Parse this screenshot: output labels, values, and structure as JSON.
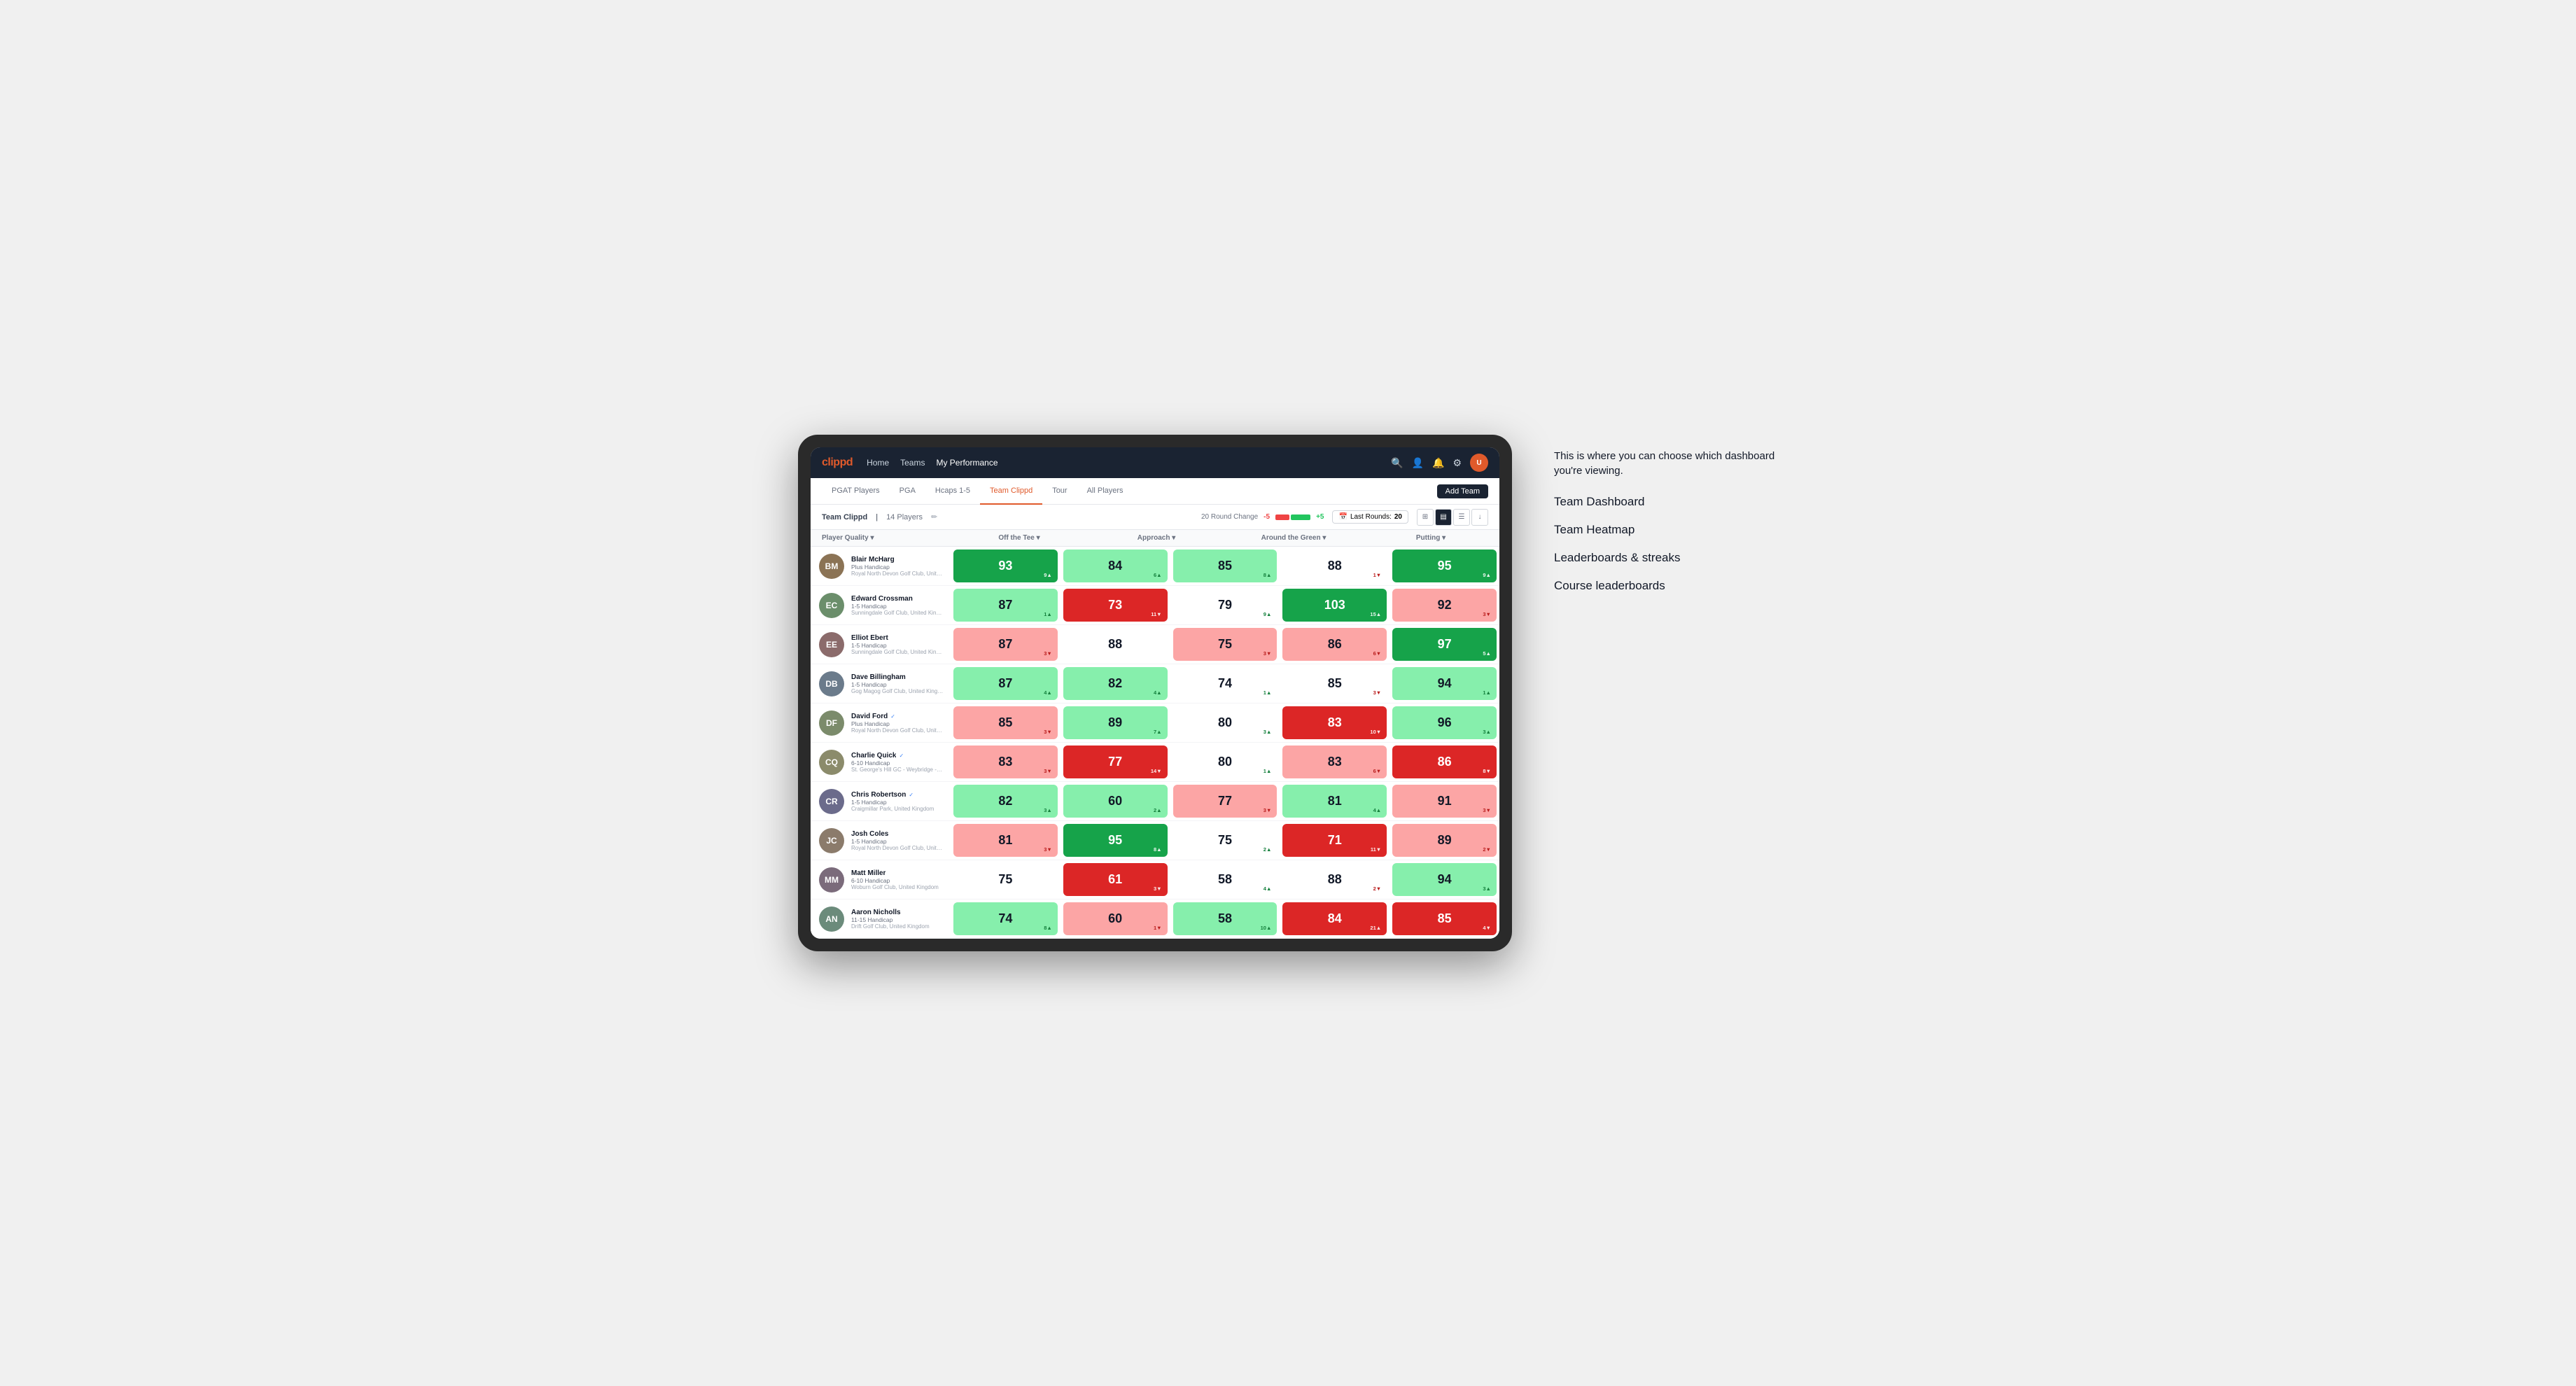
{
  "annotation": {
    "description": "This is where you can choose which dashboard you're viewing.",
    "items": [
      "Team Dashboard",
      "Team Heatmap",
      "Leaderboards & streaks",
      "Course leaderboards"
    ]
  },
  "nav": {
    "logo": "clippd",
    "links": [
      "Home",
      "Teams",
      "My Performance"
    ],
    "active_link": "My Performance"
  },
  "tabs": {
    "items": [
      "PGAT Players",
      "PGA",
      "Hcaps 1-5",
      "Team Clippd",
      "Tour",
      "All Players"
    ],
    "active": "Team Clippd",
    "add_button": "Add Team"
  },
  "subheader": {
    "team_name": "Team Clippd",
    "player_count": "14 Players",
    "round_change_label": "20 Round Change",
    "round_change_neg": "-5",
    "round_change_pos": "+5",
    "last_rounds_label": "Last Rounds:",
    "last_rounds_value": "20"
  },
  "table": {
    "columns": [
      "Player Quality ▾",
      "Off the Tee ▾",
      "Approach ▾",
      "Around the Green ▾",
      "Putting ▾"
    ],
    "players": [
      {
        "name": "Blair McHarg",
        "handicap": "Plus Handicap",
        "club": "Royal North Devon Golf Club, United Kingdom",
        "verified": false,
        "avatar_color": "#8B7355",
        "initials": "BM",
        "metrics": [
          {
            "value": "93",
            "change": "9",
            "dir": "up",
            "bg": "bg-green-strong"
          },
          {
            "value": "84",
            "change": "6",
            "dir": "up",
            "bg": "bg-green-light"
          },
          {
            "value": "85",
            "change": "8",
            "dir": "up",
            "bg": "bg-green-light"
          },
          {
            "value": "88",
            "change": "1",
            "dir": "down",
            "bg": "bg-white"
          },
          {
            "value": "95",
            "change": "9",
            "dir": "up",
            "bg": "bg-green-strong"
          }
        ]
      },
      {
        "name": "Edward Crossman",
        "handicap": "1-5 Handicap",
        "club": "Sunningdale Golf Club, United Kingdom",
        "verified": false,
        "avatar_color": "#6B8E6B",
        "initials": "EC",
        "metrics": [
          {
            "value": "87",
            "change": "1",
            "dir": "up",
            "bg": "bg-green-light"
          },
          {
            "value": "73",
            "change": "11",
            "dir": "down",
            "bg": "bg-red-strong"
          },
          {
            "value": "79",
            "change": "9",
            "dir": "up",
            "bg": "bg-white"
          },
          {
            "value": "103",
            "change": "15",
            "dir": "up",
            "bg": "bg-green-strong"
          },
          {
            "value": "92",
            "change": "3",
            "dir": "down",
            "bg": "bg-red-light"
          }
        ]
      },
      {
        "name": "Elliot Ebert",
        "handicap": "1-5 Handicap",
        "club": "Sunningdale Golf Club, United Kingdom",
        "verified": false,
        "avatar_color": "#8B6B6B",
        "initials": "EE",
        "metrics": [
          {
            "value": "87",
            "change": "3",
            "dir": "down",
            "bg": "bg-red-light"
          },
          {
            "value": "88",
            "change": "",
            "dir": "neutral",
            "bg": "bg-white"
          },
          {
            "value": "75",
            "change": "3",
            "dir": "down",
            "bg": "bg-red-light"
          },
          {
            "value": "86",
            "change": "6",
            "dir": "down",
            "bg": "bg-red-light"
          },
          {
            "value": "97",
            "change": "5",
            "dir": "up",
            "bg": "bg-green-strong"
          }
        ]
      },
      {
        "name": "Dave Billingham",
        "handicap": "1-5 Handicap",
        "club": "Gog Magog Golf Club, United Kingdom",
        "verified": false,
        "avatar_color": "#6B7B8B",
        "initials": "DB",
        "metrics": [
          {
            "value": "87",
            "change": "4",
            "dir": "up",
            "bg": "bg-green-light"
          },
          {
            "value": "82",
            "change": "4",
            "dir": "up",
            "bg": "bg-green-light"
          },
          {
            "value": "74",
            "change": "1",
            "dir": "up",
            "bg": "bg-white"
          },
          {
            "value": "85",
            "change": "3",
            "dir": "down",
            "bg": "bg-white"
          },
          {
            "value": "94",
            "change": "1",
            "dir": "up",
            "bg": "bg-green-light"
          }
        ]
      },
      {
        "name": "David Ford",
        "handicap": "Plus Handicap",
        "club": "Royal North Devon Golf Club, United Kingdom",
        "verified": true,
        "avatar_color": "#7B8B6B",
        "initials": "DF",
        "metrics": [
          {
            "value": "85",
            "change": "3",
            "dir": "down",
            "bg": "bg-red-light"
          },
          {
            "value": "89",
            "change": "7",
            "dir": "up",
            "bg": "bg-green-light"
          },
          {
            "value": "80",
            "change": "3",
            "dir": "up",
            "bg": "bg-white"
          },
          {
            "value": "83",
            "change": "10",
            "dir": "down",
            "bg": "bg-red-strong"
          },
          {
            "value": "96",
            "change": "3",
            "dir": "up",
            "bg": "bg-green-light"
          }
        ]
      },
      {
        "name": "Charlie Quick",
        "handicap": "6-10 Handicap",
        "club": "St. George's Hill GC - Weybridge - Surrey, Uni...",
        "verified": true,
        "avatar_color": "#8B8B6B",
        "initials": "CQ",
        "metrics": [
          {
            "value": "83",
            "change": "3",
            "dir": "down",
            "bg": "bg-red-light"
          },
          {
            "value": "77",
            "change": "14",
            "dir": "down",
            "bg": "bg-red-strong"
          },
          {
            "value": "80",
            "change": "1",
            "dir": "up",
            "bg": "bg-white"
          },
          {
            "value": "83",
            "change": "6",
            "dir": "down",
            "bg": "bg-red-light"
          },
          {
            "value": "86",
            "change": "8",
            "dir": "down",
            "bg": "bg-red-strong"
          }
        ]
      },
      {
        "name": "Chris Robertson",
        "handicap": "1-5 Handicap",
        "club": "Craigmillar Park, United Kingdom",
        "verified": true,
        "avatar_color": "#6B6B8B",
        "initials": "CR",
        "metrics": [
          {
            "value": "82",
            "change": "3",
            "dir": "up",
            "bg": "bg-green-light"
          },
          {
            "value": "60",
            "change": "2",
            "dir": "up",
            "bg": "bg-green-light"
          },
          {
            "value": "77",
            "change": "3",
            "dir": "down",
            "bg": "bg-red-light"
          },
          {
            "value": "81",
            "change": "4",
            "dir": "up",
            "bg": "bg-green-light"
          },
          {
            "value": "91",
            "change": "3",
            "dir": "down",
            "bg": "bg-red-light"
          }
        ]
      },
      {
        "name": "Josh Coles",
        "handicap": "1-5 Handicap",
        "club": "Royal North Devon Golf Club, United Kingdom",
        "verified": false,
        "avatar_color": "#8B7B6B",
        "initials": "JC",
        "metrics": [
          {
            "value": "81",
            "change": "3",
            "dir": "down",
            "bg": "bg-red-light"
          },
          {
            "value": "95",
            "change": "8",
            "dir": "up",
            "bg": "bg-green-strong"
          },
          {
            "value": "75",
            "change": "2",
            "dir": "up",
            "bg": "bg-white"
          },
          {
            "value": "71",
            "change": "11",
            "dir": "down",
            "bg": "bg-red-strong"
          },
          {
            "value": "89",
            "change": "2",
            "dir": "down",
            "bg": "bg-red-light"
          }
        ]
      },
      {
        "name": "Matt Miller",
        "handicap": "6-10 Handicap",
        "club": "Woburn Golf Club, United Kingdom",
        "verified": false,
        "avatar_color": "#7B6B7B",
        "initials": "MM",
        "metrics": [
          {
            "value": "75",
            "change": "",
            "dir": "neutral",
            "bg": "bg-white"
          },
          {
            "value": "61",
            "change": "3",
            "dir": "down",
            "bg": "bg-red-strong"
          },
          {
            "value": "58",
            "change": "4",
            "dir": "up",
            "bg": "bg-white"
          },
          {
            "value": "88",
            "change": "2",
            "dir": "down",
            "bg": "bg-white"
          },
          {
            "value": "94",
            "change": "3",
            "dir": "up",
            "bg": "bg-green-light"
          }
        ]
      },
      {
        "name": "Aaron Nicholls",
        "handicap": "11-15 Handicap",
        "club": "Drift Golf Club, United Kingdom",
        "verified": false,
        "avatar_color": "#6B8B7B",
        "initials": "AN",
        "metrics": [
          {
            "value": "74",
            "change": "8",
            "dir": "up",
            "bg": "bg-green-light"
          },
          {
            "value": "60",
            "change": "1",
            "dir": "down",
            "bg": "bg-red-light"
          },
          {
            "value": "58",
            "change": "10",
            "dir": "up",
            "bg": "bg-green-light"
          },
          {
            "value": "84",
            "change": "21",
            "dir": "up",
            "bg": "bg-red-strong"
          },
          {
            "value": "85",
            "change": "4",
            "dir": "down",
            "bg": "bg-red-strong"
          }
        ]
      }
    ]
  }
}
